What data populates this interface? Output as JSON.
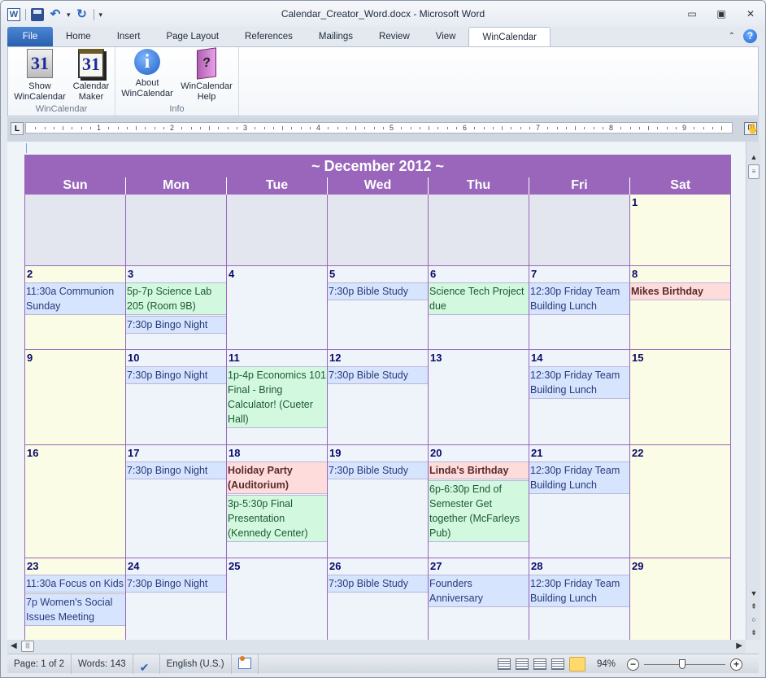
{
  "window": {
    "title": "Calendar_Creator_Word.docx - Microsoft Word",
    "controls": {
      "minimize": "minimize-icon",
      "maximize": "maximize-icon",
      "close": "close-icon"
    }
  },
  "quick_access": {
    "icons": [
      "word-logo-icon",
      "save-icon",
      "undo-icon",
      "redo-icon",
      "customize-icon"
    ],
    "word_logo_glyph": "W",
    "undo_glyph": "↶",
    "redo_glyph": "↻",
    "more_glyph": "▾"
  },
  "tabs": [
    {
      "label": "File"
    },
    {
      "label": "Home"
    },
    {
      "label": "Insert"
    },
    {
      "label": "Page Layout"
    },
    {
      "label": "References"
    },
    {
      "label": "Mailings"
    },
    {
      "label": "Review"
    },
    {
      "label": "View"
    },
    {
      "label": "WinCalendar",
      "active": true
    }
  ],
  "ribbon": {
    "groups": [
      {
        "label": "WinCalendar",
        "buttons": [
          {
            "label_line1": "Show",
            "label_line2": "WinCalendar",
            "icon_text": "31"
          },
          {
            "label_line1": "Calendar",
            "label_line2": "Maker",
            "icon_text": "31"
          }
        ]
      },
      {
        "label": "Info",
        "buttons": [
          {
            "label_line1": "About",
            "label_line2": "WinCalendar",
            "icon_text": "i"
          },
          {
            "label_line1": "WinCalendar",
            "label_line2": "Help",
            "icon_text": "?"
          }
        ]
      }
    ]
  },
  "ruler": {
    "numbers": [
      "1",
      "2",
      "3",
      "4",
      "5",
      "6",
      "7",
      "8",
      "9"
    ],
    "tab_selector": "L"
  },
  "calendar": {
    "title": "~ December 2012 ~",
    "weekdays": [
      "Sun",
      "Mon",
      "Tue",
      "Wed",
      "Thu",
      "Fri",
      "Sat"
    ],
    "colors": {
      "header": "#9966bb",
      "weekend": "#fbfce6",
      "weekday": "#eef4f9",
      "empty": "#e4e6ef",
      "event_blue": "#d6e4fe",
      "event_green": "#d2f8e0",
      "event_red": "#ffdcdc"
    },
    "weeks": [
      [
        {
          "day": "",
          "events": []
        },
        {
          "day": "",
          "events": []
        },
        {
          "day": "",
          "events": []
        },
        {
          "day": "",
          "events": []
        },
        {
          "day": "",
          "events": []
        },
        {
          "day": "",
          "events": []
        },
        {
          "day": "1",
          "events": []
        }
      ],
      [
        {
          "day": "2",
          "events": [
            {
              "text": "11:30a Communion Sunday",
              "color": "blue"
            }
          ]
        },
        {
          "day": "3",
          "events": [
            {
              "text": "5p-7p Science Lab 205 (Room 9B)",
              "color": "green"
            },
            {
              "text": "7:30p Bingo Night",
              "color": "blue"
            }
          ]
        },
        {
          "day": "4",
          "events": []
        },
        {
          "day": "5",
          "events": [
            {
              "text": "7:30p Bible Study",
              "color": "blue"
            }
          ]
        },
        {
          "day": "6",
          "events": [
            {
              "text": "Science Tech Project due",
              "color": "green"
            }
          ]
        },
        {
          "day": "7",
          "events": [
            {
              "text": "12:30p Friday Team Building Lunch",
              "color": "blue"
            }
          ]
        },
        {
          "day": "8",
          "events": [
            {
              "text": "Mikes Birthday",
              "color": "red"
            }
          ]
        }
      ],
      [
        {
          "day": "9",
          "events": []
        },
        {
          "day": "10",
          "events": [
            {
              "text": "7:30p Bingo Night",
              "color": "blue"
            }
          ]
        },
        {
          "day": "11",
          "events": [
            {
              "text": "1p-4p Economics 101 Final - Bring Calculator! (Cueter Hall)",
              "color": "green"
            }
          ]
        },
        {
          "day": "12",
          "events": [
            {
              "text": "7:30p Bible Study",
              "color": "blue"
            }
          ]
        },
        {
          "day": "13",
          "events": []
        },
        {
          "day": "14",
          "events": [
            {
              "text": "12:30p Friday Team Building Lunch",
              "color": "blue"
            }
          ]
        },
        {
          "day": "15",
          "events": []
        }
      ],
      [
        {
          "day": "16",
          "events": []
        },
        {
          "day": "17",
          "events": [
            {
              "text": "7:30p Bingo Night",
              "color": "blue"
            }
          ]
        },
        {
          "day": "18",
          "events": [
            {
              "text": "Holiday Party (Auditorium)",
              "color": "red"
            },
            {
              "text": "3p-5:30p Final Presentation (Kennedy Center)",
              "color": "green"
            }
          ]
        },
        {
          "day": "19",
          "events": [
            {
              "text": "7:30p Bible Study",
              "color": "blue"
            }
          ]
        },
        {
          "day": "20",
          "events": [
            {
              "text": "Linda's Birthday",
              "color": "red"
            },
            {
              "text": "6p-6:30p End of Semester Get together (McFarleys Pub)",
              "color": "green"
            }
          ]
        },
        {
          "day": "21",
          "events": [
            {
              "text": "12:30p Friday Team Building Lunch",
              "color": "blue"
            }
          ]
        },
        {
          "day": "22",
          "events": []
        }
      ],
      [
        {
          "day": "23",
          "events": [
            {
              "text": "11:30a Focus on Kids",
              "color": "blue"
            },
            {
              "text": "7p Women's Social Issues Meeting",
              "color": "blue"
            }
          ]
        },
        {
          "day": "24",
          "events": [
            {
              "text": "7:30p Bingo Night",
              "color": "blue"
            }
          ]
        },
        {
          "day": "25",
          "events": []
        },
        {
          "day": "26",
          "events": [
            {
              "text": "7:30p Bible Study",
              "color": "blue"
            }
          ]
        },
        {
          "day": "27",
          "events": [
            {
              "text": "Founders Anniversary",
              "color": "blue"
            }
          ]
        },
        {
          "day": "28",
          "events": [
            {
              "text": "12:30p Friday Team Building Lunch",
              "color": "blue"
            }
          ]
        },
        {
          "day": "29",
          "events": []
        }
      ]
    ]
  },
  "status_bar": {
    "page": "Page: 1 of 2",
    "words": "Words: 143",
    "language": "English (U.S.)",
    "zoom": "94%",
    "zoom_fraction": 0.47
  }
}
